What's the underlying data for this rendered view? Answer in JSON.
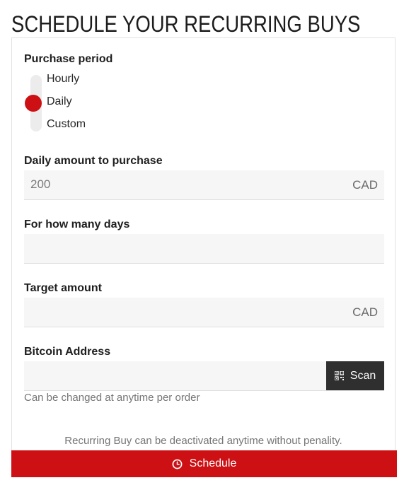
{
  "page": {
    "title": "SCHEDULE YOUR RECURRING BUYS"
  },
  "form": {
    "period": {
      "label": "Purchase period",
      "options": [
        "Hourly",
        "Daily",
        "Custom"
      ],
      "selected": "Daily"
    },
    "amount": {
      "label": "Daily amount to purchase",
      "placeholder": "200",
      "unit": "CAD"
    },
    "days": {
      "label": "For how many days",
      "placeholder": ""
    },
    "target": {
      "label": "Target amount",
      "placeholder": "",
      "unit": "CAD"
    },
    "address": {
      "label": "Bitcoin Address",
      "placeholder": "",
      "scan_label": "Scan",
      "scan_icon": "qr-code-icon",
      "help": "Can be changed at anytime per order"
    },
    "note": "Recurring Buy can be deactivated anytime without penality.",
    "submit": {
      "label": "Schedule",
      "icon": "clock-icon"
    }
  },
  "colors": {
    "accent": "#cc1014",
    "scan_bg": "#2f2f2f",
    "field_bg": "#f6f6f6"
  }
}
